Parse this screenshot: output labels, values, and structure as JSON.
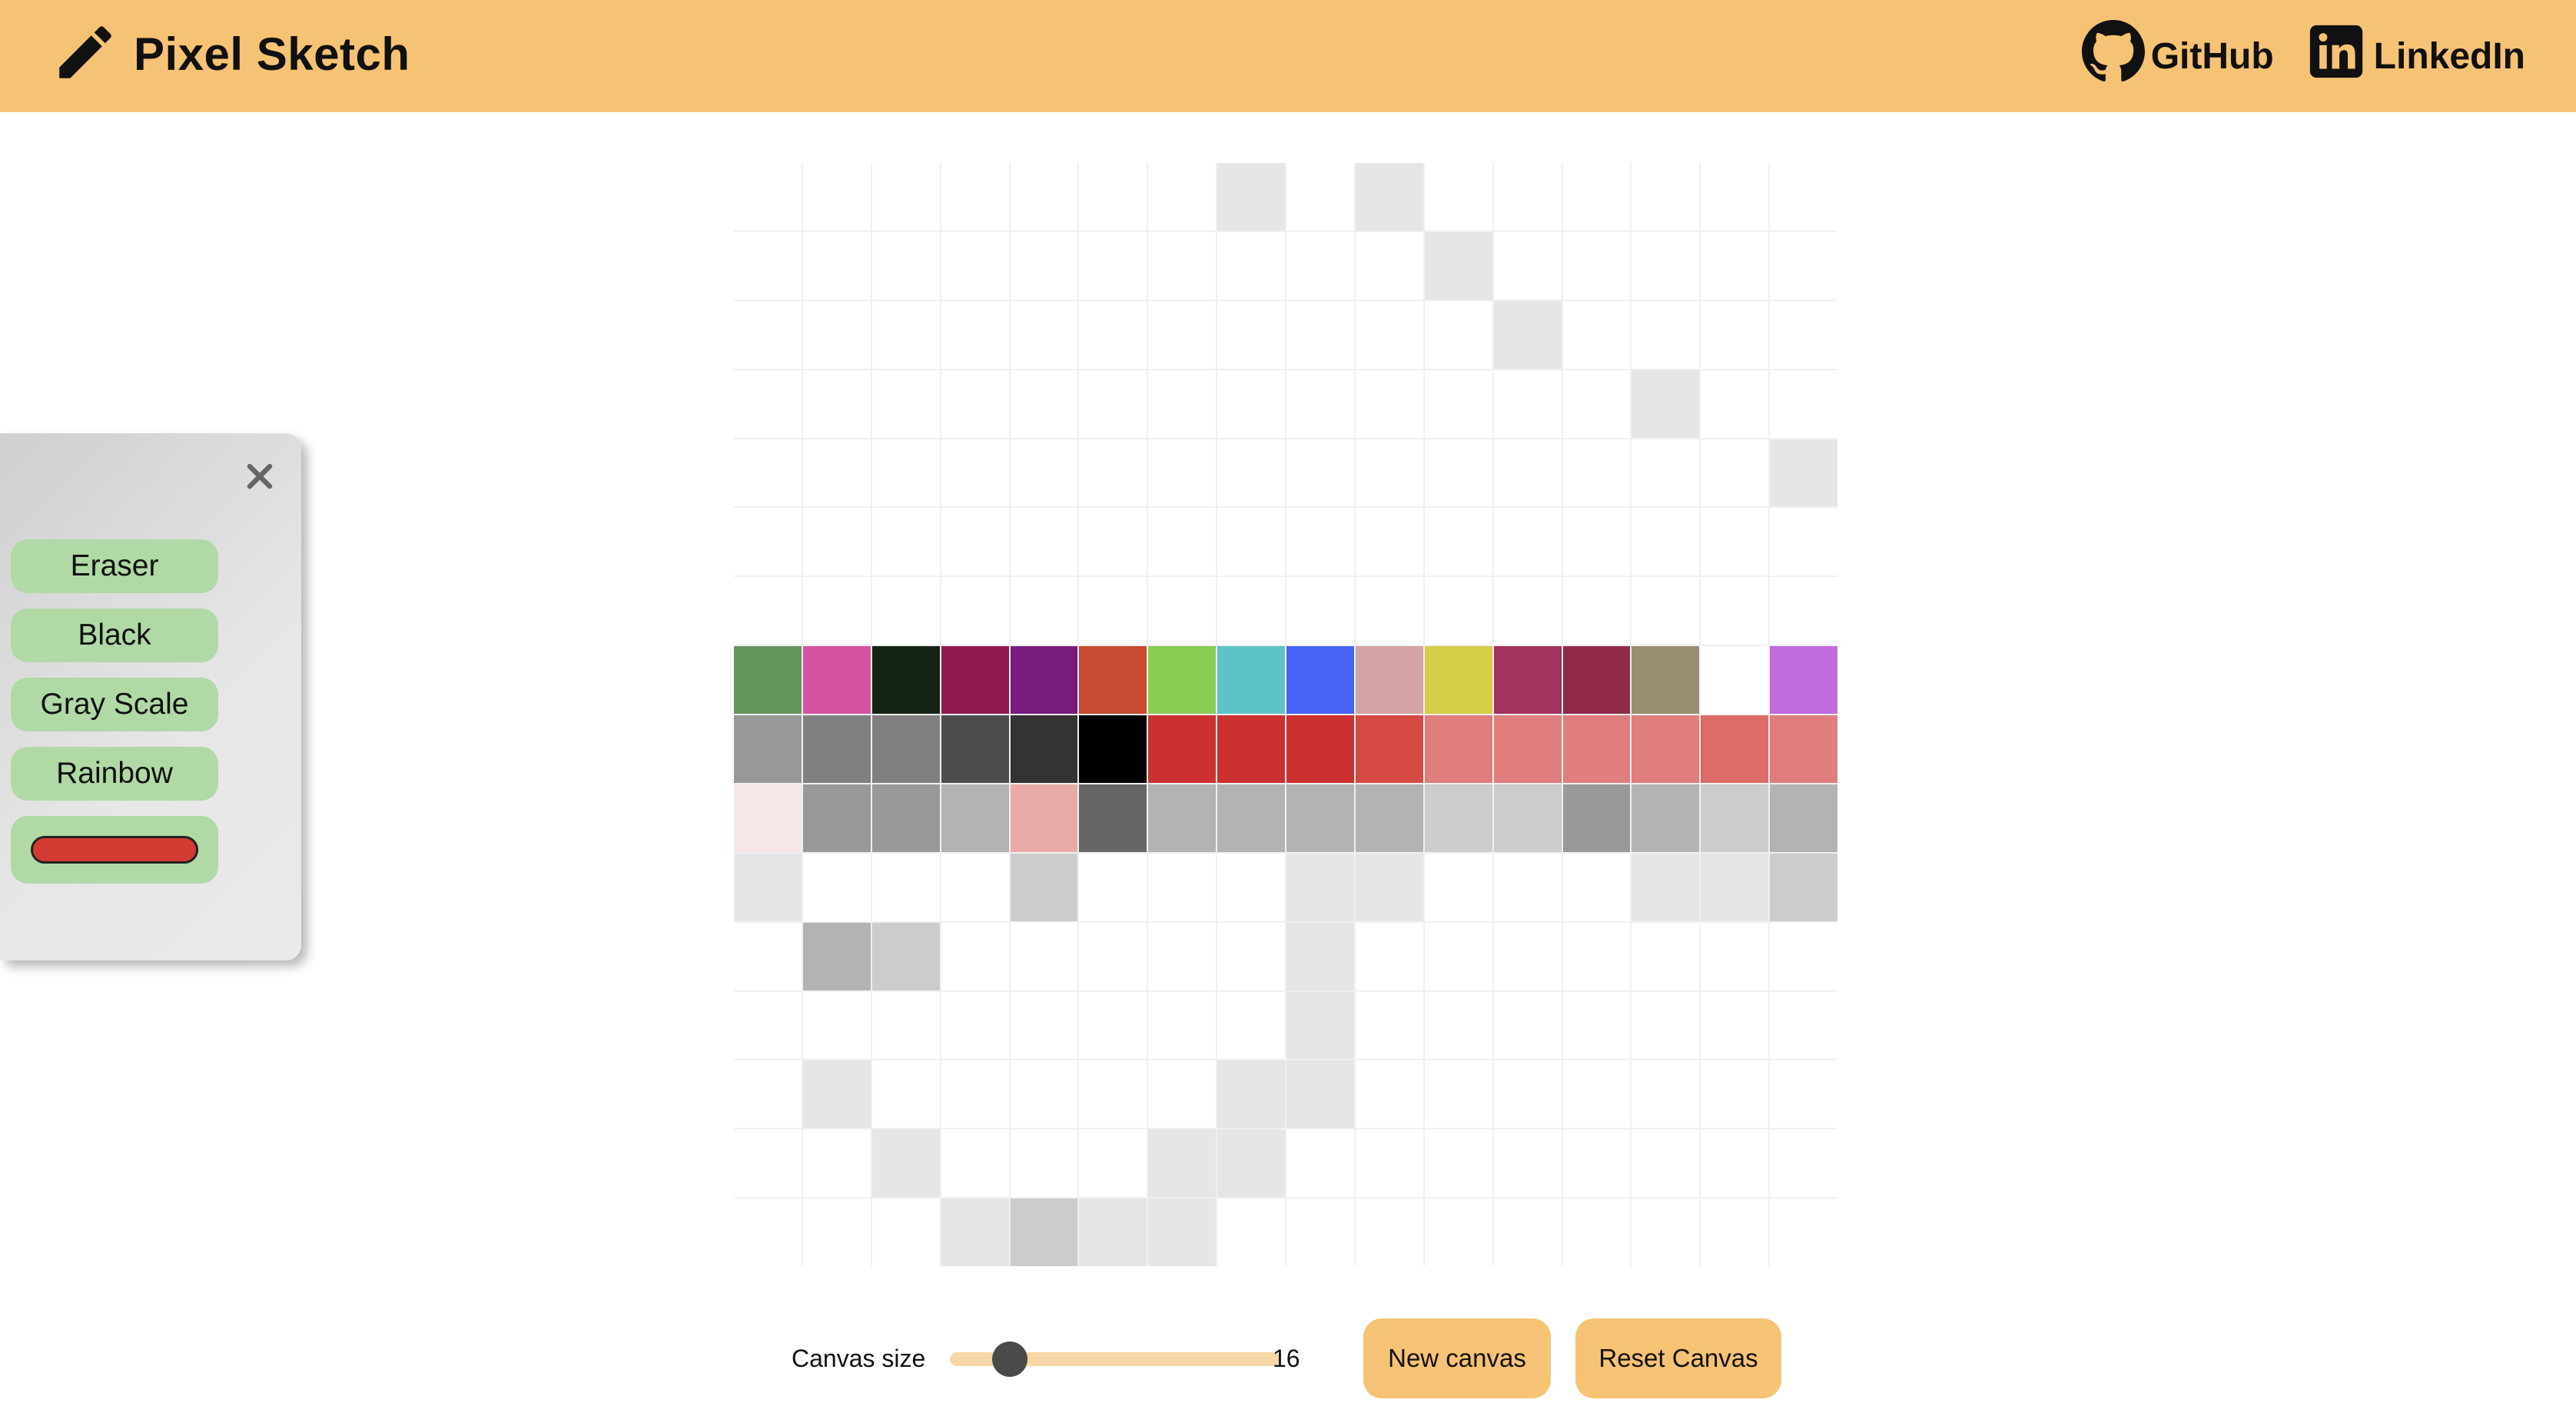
{
  "header": {
    "title": "Pixel Sketch",
    "links": [
      {
        "label": "GitHub",
        "icon": "github-icon"
      },
      {
        "label": "LinkedIn",
        "icon": "linkedin-icon"
      }
    ]
  },
  "toolbox": {
    "close_icon": "close-icon",
    "buttons": [
      "Eraser",
      "Black",
      "Gray Scale",
      "Rainbow"
    ],
    "color_picker_value": "#d23b32"
  },
  "canvas": {
    "grid_size": 16,
    "rows": [
      [
        "#ffffff",
        "#ffffff",
        "#ffffff",
        "#ffffff",
        "#ffffff",
        "#ffffff",
        "#ffffff",
        "#e6e6e6",
        "#ffffff",
        "#e6e6e6",
        "#ffffff",
        "#ffffff",
        "#ffffff",
        "#ffffff",
        "#ffffff",
        "#ffffff"
      ],
      [
        "#ffffff",
        "#ffffff",
        "#ffffff",
        "#ffffff",
        "#ffffff",
        "#ffffff",
        "#ffffff",
        "#ffffff",
        "#ffffff",
        "#ffffff",
        "#e6e6e6",
        "#ffffff",
        "#ffffff",
        "#ffffff",
        "#ffffff",
        "#ffffff"
      ],
      [
        "#ffffff",
        "#ffffff",
        "#ffffff",
        "#ffffff",
        "#ffffff",
        "#ffffff",
        "#ffffff",
        "#ffffff",
        "#ffffff",
        "#ffffff",
        "#ffffff",
        "#e6e6e6",
        "#ffffff",
        "#ffffff",
        "#ffffff",
        "#ffffff"
      ],
      [
        "#ffffff",
        "#ffffff",
        "#ffffff",
        "#ffffff",
        "#ffffff",
        "#ffffff",
        "#ffffff",
        "#ffffff",
        "#ffffff",
        "#ffffff",
        "#ffffff",
        "#ffffff",
        "#ffffff",
        "#e6e6e6",
        "#ffffff",
        "#ffffff"
      ],
      [
        "#ffffff",
        "#ffffff",
        "#ffffff",
        "#ffffff",
        "#ffffff",
        "#ffffff",
        "#ffffff",
        "#ffffff",
        "#ffffff",
        "#ffffff",
        "#ffffff",
        "#ffffff",
        "#ffffff",
        "#ffffff",
        "#ffffff",
        "#e6e6e6"
      ],
      [
        "#ffffff",
        "#ffffff",
        "#ffffff",
        "#ffffff",
        "#ffffff",
        "#ffffff",
        "#ffffff",
        "#ffffff",
        "#ffffff",
        "#ffffff",
        "#ffffff",
        "#ffffff",
        "#ffffff",
        "#ffffff",
        "#ffffff",
        "#ffffff"
      ],
      [
        "#ffffff",
        "#ffffff",
        "#ffffff",
        "#ffffff",
        "#ffffff",
        "#ffffff",
        "#ffffff",
        "#ffffff",
        "#ffffff",
        "#ffffff",
        "#ffffff",
        "#ffffff",
        "#ffffff",
        "#ffffff",
        "#ffffff",
        "#ffffff"
      ],
      [
        "#64975c",
        "#d6539f",
        "#142313",
        "#8f1b4e",
        "#781c7e",
        "#c84a30",
        "#89cc52",
        "#5ec3c9",
        "#4762f4",
        "#d4a3a4",
        "#d6cd48",
        "#a2335f",
        "#922948",
        "#9a8e72",
        "#ffffff",
        "#c26bdf"
      ],
      [
        "#999999",
        "#808080",
        "#808080",
        "#4d4d4d",
        "#333333",
        "#000000",
        "#cc3030",
        "#cc3030",
        "#cc3030",
        "#d44a42",
        "#e07d7d",
        "#e07d7d",
        "#e07d7d",
        "#e07d7d",
        "#dd6b68",
        "#e07d7d"
      ],
      [
        "#f7e6e6",
        "#999999",
        "#999999",
        "#b3b3b3",
        "#e8aba8",
        "#666666",
        "#b3b3b3",
        "#b3b3b3",
        "#b3b3b3",
        "#b3b3b3",
        "#cccccc",
        "#cccccc",
        "#999999",
        "#b3b3b3",
        "#cccccc",
        "#b3b3b3"
      ],
      [
        "#e6e6e6",
        "#ffffff",
        "#ffffff",
        "#ffffff",
        "#cccccc",
        "#ffffff",
        "#ffffff",
        "#ffffff",
        "#e6e6e6",
        "#e6e6e6",
        "#ffffff",
        "#ffffff",
        "#ffffff",
        "#e6e6e6",
        "#e6e6e6",
        "#cccccc"
      ],
      [
        "#ffffff",
        "#b3b3b3",
        "#cccccc",
        "#ffffff",
        "#ffffff",
        "#ffffff",
        "#ffffff",
        "#ffffff",
        "#e6e6e6",
        "#ffffff",
        "#ffffff",
        "#ffffff",
        "#ffffff",
        "#ffffff",
        "#ffffff",
        "#ffffff"
      ],
      [
        "#ffffff",
        "#ffffff",
        "#ffffff",
        "#ffffff",
        "#ffffff",
        "#ffffff",
        "#ffffff",
        "#ffffff",
        "#e6e6e6",
        "#ffffff",
        "#ffffff",
        "#ffffff",
        "#ffffff",
        "#ffffff",
        "#ffffff",
        "#ffffff"
      ],
      [
        "#ffffff",
        "#e6e6e6",
        "#ffffff",
        "#ffffff",
        "#ffffff",
        "#ffffff",
        "#ffffff",
        "#e6e6e6",
        "#e6e6e6",
        "#ffffff",
        "#ffffff",
        "#ffffff",
        "#ffffff",
        "#ffffff",
        "#ffffff",
        "#ffffff"
      ],
      [
        "#ffffff",
        "#ffffff",
        "#e6e6e6",
        "#ffffff",
        "#ffffff",
        "#ffffff",
        "#e6e6e6",
        "#e6e6e6",
        "#ffffff",
        "#ffffff",
        "#ffffff",
        "#ffffff",
        "#ffffff",
        "#ffffff",
        "#ffffff",
        "#ffffff"
      ],
      [
        "#ffffff",
        "#ffffff",
        "#ffffff",
        "#e6e6e6",
        "#cccccc",
        "#e6e6e6",
        "#e6e6e6",
        "#ffffff",
        "#ffffff",
        "#ffffff",
        "#ffffff",
        "#ffffff",
        "#ffffff",
        "#ffffff",
        "#ffffff",
        "#ffffff"
      ]
    ]
  },
  "controls": {
    "size_label": "Canvas size",
    "size_value": "16",
    "size_min": 2,
    "size_max": 100,
    "new_label": "New canvas",
    "reset_label": "Reset Canvas"
  },
  "colors": {
    "header_bg": "#f6c374",
    "tool_button_bg": "#b0d9a6",
    "slider_track": "#f8d7a6",
    "slider_thumb": "#4a4a4a"
  }
}
